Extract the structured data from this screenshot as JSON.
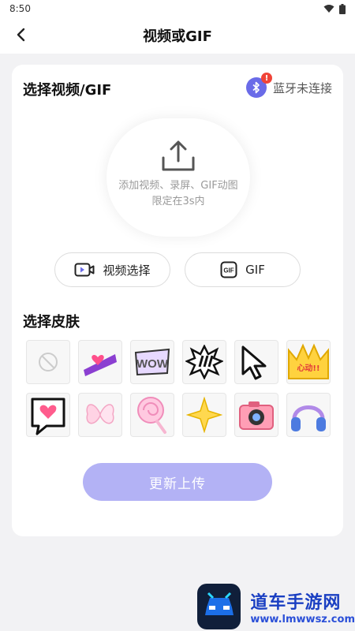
{
  "status_bar": {
    "time": "8:50"
  },
  "nav": {
    "title": "视频或GIF"
  },
  "video_section": {
    "title": "选择视频/GIF",
    "bluetooth_badge": "!",
    "bluetooth_status": "蓝牙未连接",
    "upload_line1": "添加视频、录屏、GIF动图",
    "upload_line2": "限定在3s内",
    "video_button": "视频选择",
    "gif_button": "GIF",
    "gif_icon_text": "GIF"
  },
  "skins_section": {
    "title": "选择皮肤",
    "items": [
      {
        "icon": "none-icon"
      },
      {
        "icon": "love-sticker-icon"
      },
      {
        "icon": "wow-sticker-icon"
      },
      {
        "icon": "pow-burst-icon"
      },
      {
        "icon": "cursor-icon"
      },
      {
        "icon": "crown-icon"
      },
      {
        "icon": "heart-bubble-icon"
      },
      {
        "icon": "butterfly-icon"
      },
      {
        "icon": "lollipop-icon"
      },
      {
        "icon": "sparkle-icon"
      },
      {
        "icon": "camera-icon"
      },
      {
        "icon": "headphones-icon"
      }
    ],
    "crown_text": "心动!!"
  },
  "update_button": "更新上传",
  "watermark": {
    "name": "道车手游网",
    "url": "www.lmwwsz.com"
  },
  "colors": {
    "accent": "#6a6be8",
    "button_disabled": "#b3b2f5",
    "badge": "#f04438"
  }
}
